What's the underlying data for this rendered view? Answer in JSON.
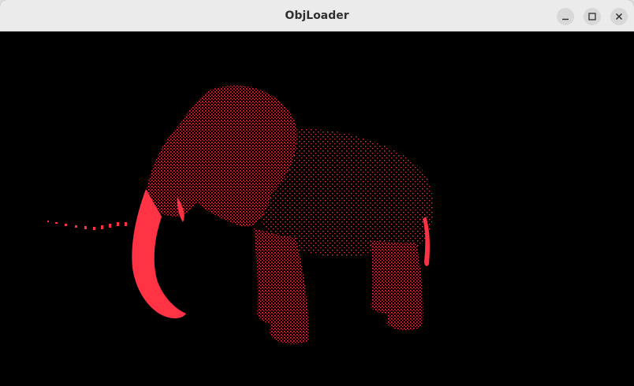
{
  "window": {
    "title": "ObjLoader"
  },
  "controls": {
    "minimize": "minimize-icon",
    "maximize": "maximize-icon",
    "close": "close-icon"
  },
  "viewport": {
    "background": "#000000",
    "point_color": "#ff3344",
    "model": "elephant"
  }
}
